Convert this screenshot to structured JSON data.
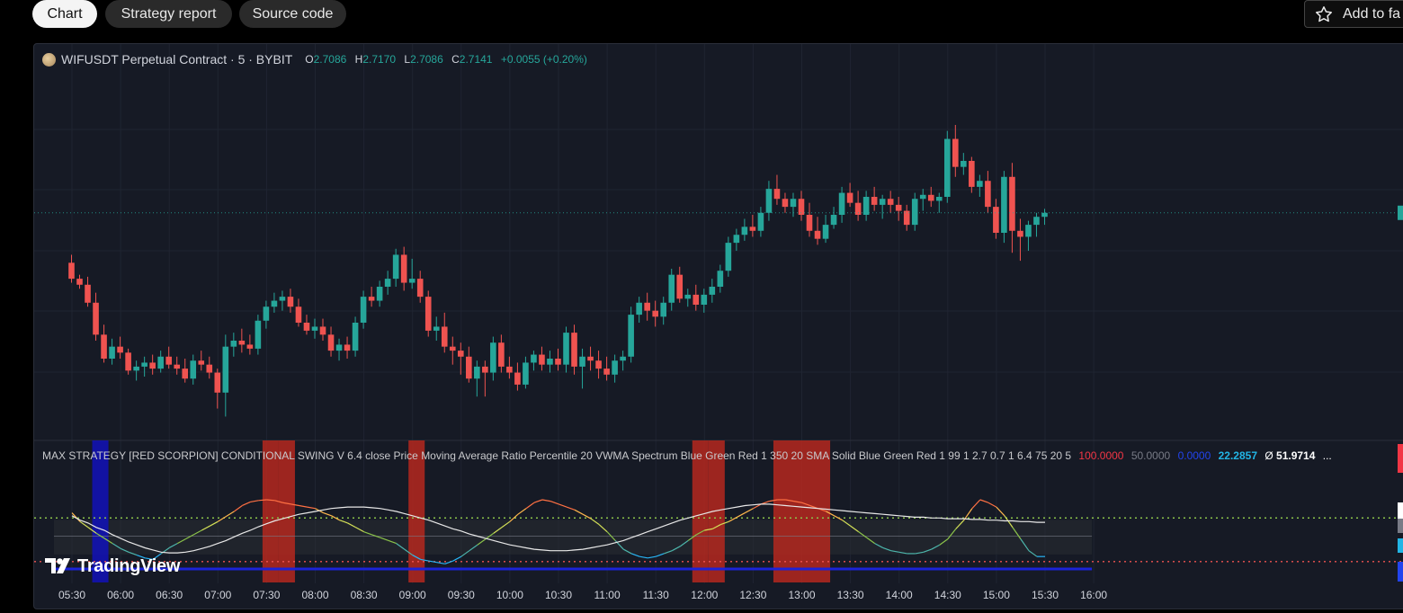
{
  "tabs": [
    {
      "label": "Chart",
      "active": true
    },
    {
      "label": "Strategy report",
      "active": false
    },
    {
      "label": "Source code",
      "active": false
    }
  ],
  "favorite": {
    "label": "Add to fa",
    "icon": "star-icon"
  },
  "legend": {
    "symbol": "WIFUSDT Perpetual Contract · 5 · BYBIT",
    "open_key": "O",
    "open": "2.7086",
    "high_key": "H",
    "high": "2.7170",
    "low_key": "L",
    "low": "2.7086",
    "close_key": "C",
    "close": "2.7141",
    "change": "+0.0055 (+0.20%)"
  },
  "indicator": {
    "title": "MAX STRATEGY [RED SCORPION] CONDITIONAL SWING V 6.4 close Price Moving Average Ratio Percentile 20 VWMA Spectrum Blue Green Red 1 350 20 SMA Solid Blue Green Red 1 99 1 2.7 0.7 1 6.4 75 20 5",
    "value_red": "100.0000",
    "value_gray": "50.0000",
    "value_blue": "0.0000",
    "value_cyan": "22.2857",
    "value_phi": "Ø",
    "value_white": "51.9714",
    "more": "..."
  },
  "branding": {
    "label": "TradingView"
  },
  "time_axis": [
    "05:30",
    "06:00",
    "06:30",
    "07:00",
    "07:30",
    "08:00",
    "08:30",
    "09:00",
    "09:30",
    "10:00",
    "10:30",
    "11:00",
    "11:30",
    "12:00",
    "12:30",
    "13:00",
    "13:30",
    "14:00",
    "14:30",
    "15:00",
    "15:30",
    "16:00"
  ],
  "colors": {
    "up": "#26a69a",
    "down": "#ef5350",
    "background": "#161a25",
    "highlight": "#b5281e",
    "band": "#1212b8"
  },
  "chart_data": {
    "type": "candlestick",
    "interval": "5m",
    "price_candles_ohlc": [
      [
        2.684,
        2.688,
        2.674,
        2.676
      ],
      [
        2.676,
        2.678,
        2.671,
        2.673
      ],
      [
        2.673,
        2.677,
        2.662,
        2.664
      ],
      [
        2.664,
        2.669,
        2.645,
        2.648
      ],
      [
        2.648,
        2.653,
        2.634,
        2.636
      ],
      [
        2.636,
        2.646,
        2.633,
        2.642
      ],
      [
        2.642,
        2.647,
        2.636,
        2.639
      ],
      [
        2.639,
        2.641,
        2.628,
        2.63
      ],
      [
        2.63,
        2.635,
        2.625,
        2.632
      ],
      [
        2.632,
        2.637,
        2.627,
        2.634
      ],
      [
        2.634,
        2.638,
        2.628,
        2.631
      ],
      [
        2.631,
        2.64,
        2.629,
        2.637
      ],
      [
        2.637,
        2.642,
        2.631,
        2.633
      ],
      [
        2.633,
        2.637,
        2.628,
        2.631
      ],
      [
        2.631,
        2.636,
        2.624,
        2.626
      ],
      [
        2.626,
        2.638,
        2.623,
        2.635
      ],
      [
        2.635,
        2.64,
        2.63,
        2.633
      ],
      [
        2.633,
        2.637,
        2.626,
        2.629
      ],
      [
        2.629,
        2.631,
        2.611,
        2.619
      ],
      [
        2.619,
        2.648,
        2.607,
        2.642
      ],
      [
        2.642,
        2.649,
        2.637,
        2.645
      ],
      [
        2.645,
        2.651,
        2.639,
        2.643
      ],
      [
        2.643,
        2.648,
        2.638,
        2.641
      ],
      [
        2.641,
        2.658,
        2.638,
        2.655
      ],
      [
        2.655,
        2.665,
        2.651,
        2.662
      ],
      [
        2.662,
        2.669,
        2.659,
        2.665
      ],
      [
        2.665,
        2.67,
        2.66,
        2.667
      ],
      [
        2.667,
        2.671,
        2.659,
        2.662
      ],
      [
        2.662,
        2.666,
        2.652,
        2.654
      ],
      [
        2.654,
        2.658,
        2.648,
        2.65
      ],
      [
        2.65,
        2.656,
        2.646,
        2.652
      ],
      [
        2.652,
        2.656,
        2.645,
        2.648
      ],
      [
        2.648,
        2.652,
        2.637,
        2.64
      ],
      [
        2.64,
        2.646,
        2.635,
        2.643
      ],
      [
        2.643,
        2.647,
        2.636,
        2.64
      ],
      [
        2.64,
        2.657,
        2.637,
        2.654
      ],
      [
        2.654,
        2.67,
        2.651,
        2.667
      ],
      [
        2.667,
        2.672,
        2.662,
        2.665
      ],
      [
        2.665,
        2.675,
        2.662,
        2.672
      ],
      [
        2.672,
        2.68,
        2.668,
        2.676
      ],
      [
        2.676,
        2.691,
        2.672,
        2.688
      ],
      [
        2.688,
        2.692,
        2.67,
        2.674
      ],
      [
        2.674,
        2.686,
        2.671,
        2.676
      ],
      [
        2.676,
        2.68,
        2.664,
        2.667
      ],
      [
        2.667,
        2.67,
        2.647,
        2.65
      ],
      [
        2.65,
        2.657,
        2.645,
        2.652
      ],
      [
        2.652,
        2.659,
        2.639,
        2.642
      ],
      [
        2.642,
        2.647,
        2.633,
        2.64
      ],
      [
        2.64,
        2.644,
        2.628,
        2.637
      ],
      [
        2.637,
        2.642,
        2.624,
        2.626
      ],
      [
        2.626,
        2.635,
        2.617,
        2.632
      ],
      [
        2.632,
        2.635,
        2.617,
        2.629
      ],
      [
        2.629,
        2.647,
        2.625,
        2.644
      ],
      [
        2.644,
        2.648,
        2.629,
        2.632
      ],
      [
        2.632,
        2.637,
        2.626,
        2.629
      ],
      [
        2.629,
        2.634,
        2.62,
        2.623
      ],
      [
        2.623,
        2.637,
        2.621,
        2.634
      ],
      [
        2.634,
        2.64,
        2.63,
        2.638
      ],
      [
        2.638,
        2.642,
        2.63,
        2.633
      ],
      [
        2.633,
        2.64,
        2.629,
        2.636
      ],
      [
        2.636,
        2.641,
        2.63,
        2.633
      ],
      [
        2.633,
        2.652,
        2.629,
        2.649
      ],
      [
        2.649,
        2.653,
        2.628,
        2.632
      ],
      [
        2.632,
        2.641,
        2.621,
        2.637
      ],
      [
        2.637,
        2.642,
        2.63,
        2.635
      ],
      [
        2.635,
        2.64,
        2.626,
        2.631
      ],
      [
        2.631,
        2.637,
        2.625,
        2.628
      ],
      [
        2.628,
        2.638,
        2.624,
        2.635
      ],
      [
        2.635,
        2.64,
        2.63,
        2.637
      ],
      [
        2.637,
        2.662,
        2.634,
        2.658
      ],
      [
        2.658,
        2.667,
        2.654,
        2.664
      ],
      [
        2.664,
        2.669,
        2.655,
        2.66
      ],
      [
        2.66,
        2.665,
        2.652,
        2.657
      ],
      [
        2.657,
        2.667,
        2.653,
        2.664
      ],
      [
        2.664,
        2.681,
        2.66,
        2.678
      ],
      [
        2.678,
        2.682,
        2.664,
        2.666
      ],
      [
        2.666,
        2.671,
        2.662,
        2.668
      ],
      [
        2.668,
        2.673,
        2.66,
        2.663
      ],
      [
        2.663,
        2.671,
        2.659,
        2.668
      ],
      [
        2.668,
        2.676,
        2.664,
        2.672
      ],
      [
        2.672,
        2.683,
        2.669,
        2.68
      ],
      [
        2.68,
        2.697,
        2.677,
        2.694
      ],
      [
        2.694,
        2.701,
        2.69,
        2.698
      ],
      [
        2.698,
        2.706,
        2.695,
        2.702
      ],
      [
        2.702,
        2.708,
        2.697,
        2.7
      ],
      [
        2.7,
        2.712,
        2.697,
        2.709
      ],
      [
        2.709,
        2.725,
        2.705,
        2.721
      ],
      [
        2.721,
        2.728,
        2.713,
        2.716
      ],
      [
        2.716,
        2.719,
        2.709,
        2.712
      ],
      [
        2.712,
        2.719,
        2.707,
        2.716
      ],
      [
        2.716,
        2.72,
        2.705,
        2.708
      ],
      [
        2.708,
        2.714,
        2.697,
        2.7
      ],
      [
        2.7,
        2.707,
        2.693,
        2.696
      ],
      [
        2.696,
        2.708,
        2.694,
        2.703
      ],
      [
        2.703,
        2.712,
        2.701,
        2.708
      ],
      [
        2.708,
        2.722,
        2.704,
        2.719
      ],
      [
        2.719,
        2.724,
        2.712,
        2.714
      ],
      [
        2.714,
        2.72,
        2.705,
        2.708
      ],
      [
        2.708,
        2.72,
        2.705,
        2.717
      ],
      [
        2.717,
        2.722,
        2.71,
        2.713
      ],
      [
        2.713,
        2.718,
        2.706,
        2.716
      ],
      [
        2.716,
        2.72,
        2.709,
        2.713
      ],
      [
        2.713,
        2.717,
        2.705,
        2.71
      ],
      [
        2.71,
        2.713,
        2.7,
        2.703
      ],
      [
        2.703,
        2.719,
        2.7,
        2.716
      ],
      [
        2.716,
        2.721,
        2.71,
        2.718
      ],
      [
        2.718,
        2.722,
        2.712,
        2.715
      ],
      [
        2.715,
        2.719,
        2.709,
        2.717
      ],
      [
        2.717,
        2.75,
        2.714,
        2.746
      ],
      [
        2.746,
        2.753,
        2.727,
        2.732
      ],
      [
        2.732,
        2.739,
        2.728,
        2.735
      ],
      [
        2.735,
        2.737,
        2.719,
        2.722
      ],
      [
        2.722,
        2.728,
        2.717,
        2.725
      ],
      [
        2.725,
        2.73,
        2.709,
        2.712
      ],
      [
        2.712,
        2.716,
        2.696,
        2.699
      ],
      [
        2.699,
        2.73,
        2.694,
        2.727
      ],
      [
        2.727,
        2.734,
        2.689,
        2.7
      ],
      [
        2.7,
        2.706,
        2.685,
        2.697
      ],
      [
        2.697,
        2.705,
        2.69,
        2.703
      ],
      [
        2.703,
        2.709,
        2.697,
        2.707
      ],
      [
        2.707,
        2.711,
        2.703,
        2.709
      ]
    ],
    "price_range": [
      2.6,
      2.78
    ],
    "highlighted_time_windows": [
      [
        "07:30",
        "07:35"
      ],
      [
        "07:40",
        "07:45"
      ],
      [
        "09:00",
        "09:05"
      ],
      [
        "11:55",
        "12:00"
      ],
      [
        "12:05",
        "12:10"
      ],
      [
        "12:45",
        "13:15"
      ]
    ],
    "blue_band_time_window": [
      [
        "05:45",
        "05:50"
      ]
    ],
    "oscillator_levels": {
      "upper": 75,
      "mid": 50,
      "lower": 20,
      "range": [
        0,
        100
      ]
    },
    "oscillator_values": [
      82,
      70,
      62,
      54,
      47,
      40,
      33,
      28,
      24,
      20,
      18,
      26,
      34,
      40,
      46,
      52,
      58,
      64,
      70,
      77,
      84,
      92,
      97,
      99,
      100,
      99,
      96,
      94,
      92,
      90,
      88,
      82,
      78,
      72,
      68,
      62,
      56,
      52,
      48,
      44,
      40,
      32,
      24,
      18,
      16,
      14,
      12,
      16,
      22,
      30,
      38,
      46,
      54,
      62,
      70,
      80,
      88,
      96,
      100,
      98,
      94,
      90,
      86,
      80,
      74,
      66,
      56,
      44,
      32,
      26,
      22,
      20,
      22,
      26,
      30,
      36,
      44,
      52,
      58,
      60,
      66,
      70,
      76,
      82,
      88,
      94,
      98,
      100,
      100,
      98,
      96,
      92,
      88,
      84,
      78,
      72,
      64,
      56,
      48,
      40,
      34,
      30,
      28,
      26,
      26,
      28,
      32,
      38,
      46,
      60,
      72,
      88,
      100,
      96,
      90,
      78,
      62,
      46,
      30,
      22,
      22
    ],
    "signal_line": [
      78,
      72,
      68,
      62,
      58,
      52,
      47,
      42,
      38,
      34,
      31,
      28,
      27,
      27,
      28,
      30,
      33,
      36,
      40,
      44,
      49,
      54,
      58,
      63,
      67,
      71,
      74,
      77,
      80,
      82,
      84,
      86,
      88,
      89,
      90,
      90,
      90,
      89,
      88,
      86,
      84,
      81,
      78,
      75,
      72,
      68,
      64,
      60,
      57,
      53,
      50,
      47,
      44,
      41,
      38,
      36,
      34,
      32,
      31,
      30,
      30,
      30,
      31,
      32,
      34,
      36,
      38,
      41,
      44,
      48,
      52,
      56,
      60,
      64,
      68,
      72,
      75,
      78,
      81,
      84,
      86,
      88,
      90,
      92,
      93,
      94,
      94,
      93,
      92,
      91,
      90,
      89,
      88,
      87,
      86,
      85,
      84,
      83,
      82,
      81,
      80,
      79,
      78,
      77,
      76,
      76,
      75,
      75,
      74,
      74,
      74,
      73,
      73,
      72,
      72,
      71,
      71,
      70,
      70,
      69,
      69
    ]
  }
}
